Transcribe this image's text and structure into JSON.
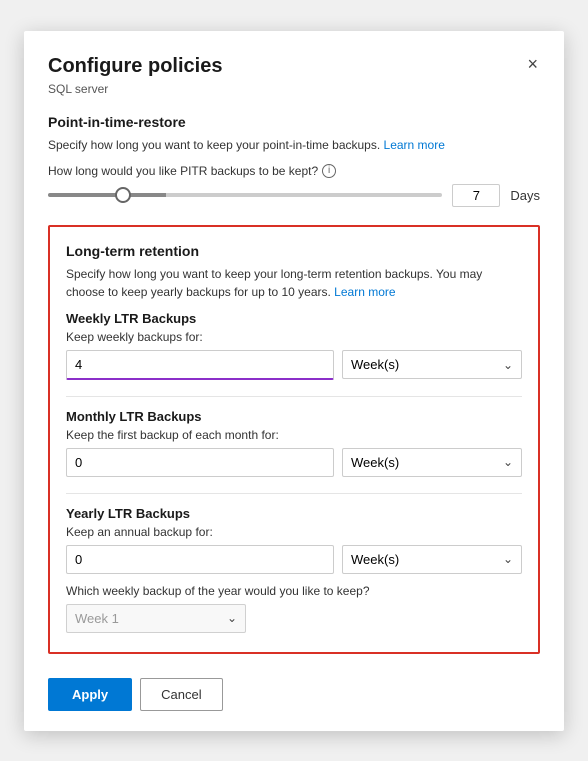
{
  "dialog": {
    "title": "Configure policies",
    "subtitle": "SQL server",
    "close_label": "×"
  },
  "pitr": {
    "section_title": "Point-in-time-restore",
    "description": "Specify how long you want to keep your point-in-time backups.",
    "learn_more_label": "Learn more",
    "slider_label": "How long would you like PITR backups to be kept?",
    "days_value": "7",
    "days_unit": "Days"
  },
  "ltr": {
    "section_title": "Long-term retention",
    "description": "Specify how long you want to keep your long-term retention backups. You may choose to keep yearly backups for up to 10 years.",
    "learn_more_label": "Learn more",
    "weekly": {
      "title": "Weekly LTR Backups",
      "label": "Keep weekly backups for:",
      "value": "4",
      "unit": "Week(s)"
    },
    "monthly": {
      "title": "Monthly LTR Backups",
      "label": "Keep the first backup of each month for:",
      "value": "0",
      "unit": "Week(s)"
    },
    "yearly": {
      "title": "Yearly LTR Backups",
      "label": "Keep an annual backup for:",
      "value": "0",
      "unit": "Week(s)",
      "week_question": "Which weekly backup of the year would you like to keep?",
      "week_placeholder": "Week 1"
    }
  },
  "footer": {
    "apply_label": "Apply",
    "cancel_label": "Cancel"
  }
}
